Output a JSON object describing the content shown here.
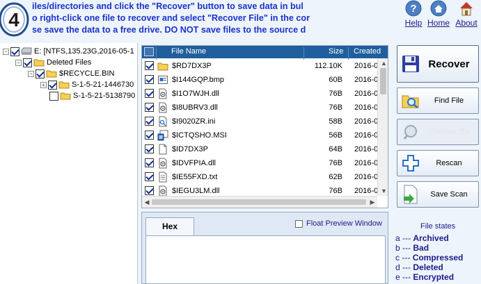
{
  "step": {
    "number": "4",
    "lines": [
      "iles/directories and click the \"Recover\" button to save data in bul",
      "o right-click one file to recover and select \"Recover File\" in the cor",
      "se save the data to a free drive. DO NOT save files to the source d"
    ]
  },
  "top_links": {
    "help": "Help",
    "home": "Home",
    "about": "About"
  },
  "tree": [
    {
      "label": "E:  [NTFS,135.23G,2016-05-1",
      "checked": true
    },
    {
      "label": "Deleted Files",
      "checked": true
    },
    {
      "label": "$RECYCLE.BIN",
      "checked": true
    },
    {
      "label": "S-1-5-21-1446730",
      "checked": true
    },
    {
      "label": "S-1-5-21-5138790",
      "checked": false
    }
  ],
  "table": {
    "columns": {
      "name": "File Name",
      "size": "Size",
      "created": "Created"
    },
    "rows": [
      {
        "name": "$RD7DX3P",
        "size": "112.10K",
        "created": "2016-0",
        "icon": "folder-icon"
      },
      {
        "name": "$I144GQP.bmp",
        "size": "60B",
        "created": "2016-0",
        "icon": "bitmap-file-icon"
      },
      {
        "name": "$I1O7WJH.dll",
        "size": "76B",
        "created": "2016-0",
        "icon": "dll-file-icon"
      },
      {
        "name": "$I8UBRV3.dll",
        "size": "76B",
        "created": "2016-0",
        "icon": "dll-file-icon"
      },
      {
        "name": "$I9020ZR.ini",
        "size": "58B",
        "created": "2016-0",
        "icon": "ini-file-icon"
      },
      {
        "name": "$ICTQSHO.MSI",
        "size": "56B",
        "created": "2016-0",
        "icon": "msi-file-icon"
      },
      {
        "name": "$ID7DX3P",
        "size": "64B",
        "created": "2016-0",
        "icon": "blank-file-icon"
      },
      {
        "name": "$IDVFPIA.dll",
        "size": "76B",
        "created": "2016-0",
        "icon": "dll-file-icon"
      },
      {
        "name": "$IE55FXD.txt",
        "size": "62B",
        "created": "2016-0",
        "icon": "text-file-icon"
      },
      {
        "name": "$IEGU3LM.dll",
        "size": "76B",
        "created": "2016-0",
        "icon": "dll-file-icon"
      }
    ]
  },
  "preview": {
    "hex_tab": "Hex",
    "float_label": "Float Preview Window"
  },
  "buttons": {
    "recover": "Recover",
    "find_file": "Find File",
    "preview_file": "Preview File",
    "rescan": "Rescan",
    "save_scan": "Save Scan"
  },
  "file_states": {
    "title": "File states",
    "items": [
      {
        "key": "a",
        "sep": "---",
        "name": "Archived"
      },
      {
        "key": "b",
        "sep": "---",
        "name": "Bad"
      },
      {
        "key": "c",
        "sep": "---",
        "name": "Compressed"
      },
      {
        "key": "d",
        "sep": "---",
        "name": "Deleted"
      },
      {
        "key": "e",
        "sep": "---",
        "name": "Encrypted"
      }
    ]
  },
  "colors": {
    "accent_text": "#1a32c8",
    "header_bg": "#1f5f9d",
    "link": "#1a1a8a"
  }
}
